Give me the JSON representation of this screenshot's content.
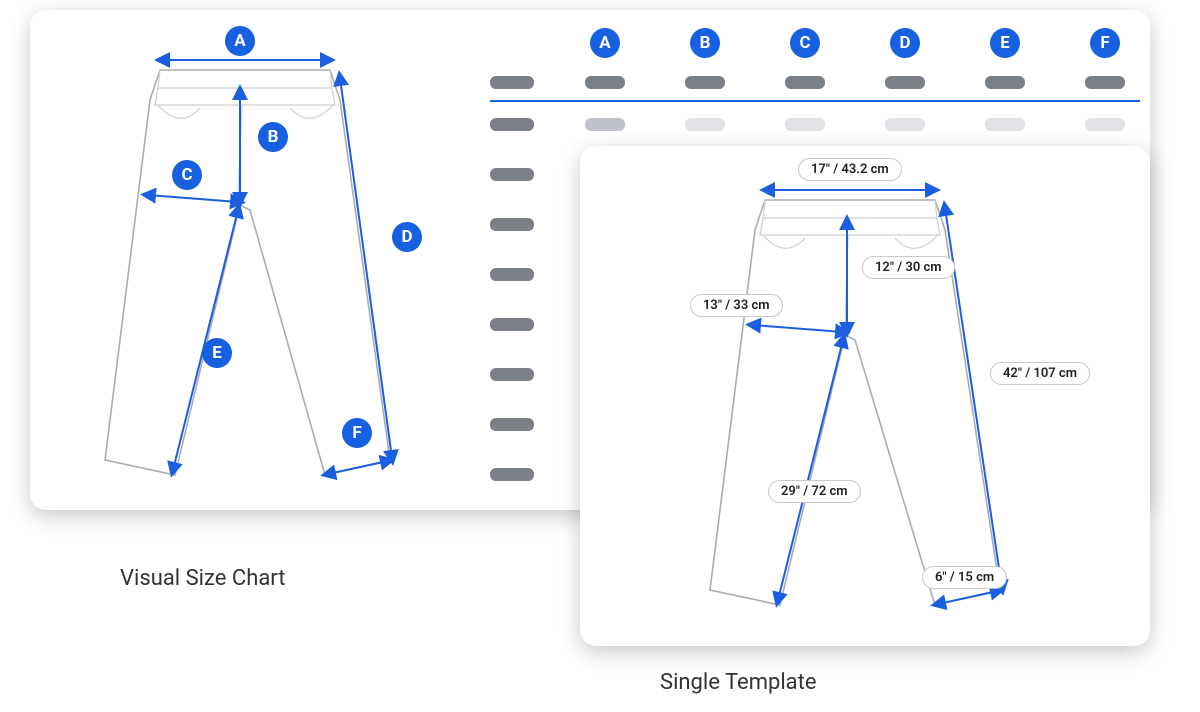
{
  "captions": {
    "visual_chart": "Visual Size Chart",
    "single_template": "Single Template"
  },
  "letters": [
    "A",
    "B",
    "C",
    "D",
    "E",
    "F"
  ],
  "left_badges": {
    "A": "A",
    "B": "B",
    "C": "C",
    "D": "D",
    "E": "E",
    "F": "F"
  },
  "table": {
    "columns": [
      "A",
      "B",
      "C",
      "D",
      "E",
      "F"
    ],
    "rows": 8
  },
  "measurements": {
    "waist": "17″ / 43.2 cm",
    "rise": "12″ / 30 cm",
    "thigh": "13″ / 33 cm",
    "outseam": "42″ / 107 cm",
    "inseam": "29″ / 72 cm",
    "hem": "6″ / 15 cm"
  }
}
